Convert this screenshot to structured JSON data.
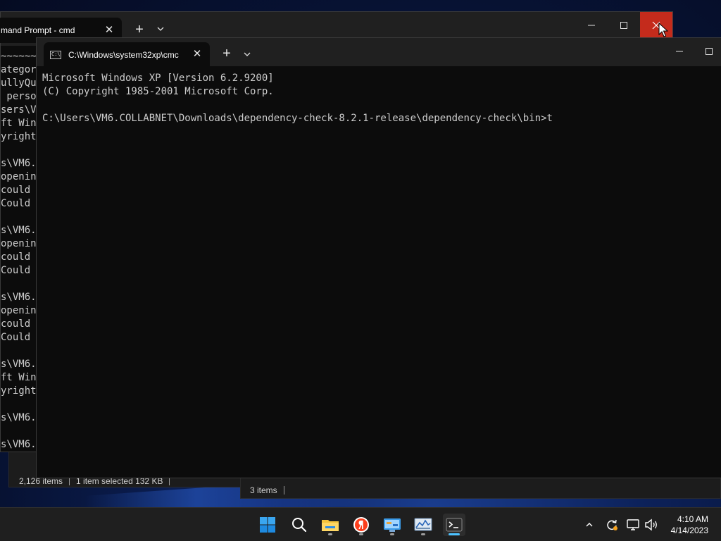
{
  "back_window": {
    "tab_title": "mand Prompt - cmd",
    "partial_lines": [
      "~~~~~~",
      "ategor",
      "ullyQu",
      " perso",
      "sers\\V",
      "ft Win",
      "yright",
      "",
      "s\\VM6.",
      "openin",
      "could ",
      "Could ",
      "",
      "s\\VM6.",
      "openin",
      "could ",
      "Could ",
      "",
      "s\\VM6.",
      "openin",
      "could ",
      "Could ",
      "",
      "s\\VM6.",
      "ft Win",
      "yright",
      "",
      "s\\VM6.",
      "",
      "s\\VM6."
    ]
  },
  "front_window": {
    "tab_title": "C:\\Windows\\system32xp\\cmc",
    "lines": [
      "Microsoft Windows XP [Version 6.2.9200]",
      "(C) Copyright 1985-2001 Microsoft Corp.",
      "",
      "C:\\Users\\VM6.COLLABNET\\Downloads\\dependency-check-8.2.1-release\\dependency-check\\bin>t"
    ]
  },
  "explorer_left": {
    "items_count": "2,126 items",
    "selection": "1 item selected  132 KB"
  },
  "explorer_right": {
    "items_count": "3 items"
  },
  "taskbar": {
    "time": "4:10 AM",
    "date": "4/14/2023",
    "apps": [
      "start-icon",
      "search-icon",
      "file-explorer-icon",
      "yandex-browser-icon",
      "control-panel-icon",
      "resource-monitor-icon",
      "terminal-icon"
    ],
    "active_app": "terminal-icon"
  },
  "colors": {
    "close_hover": "#c42b1c",
    "terminal_bg": "#0c0c0c",
    "titlebar_bg": "#202020",
    "accent": "#4cc2ff"
  }
}
